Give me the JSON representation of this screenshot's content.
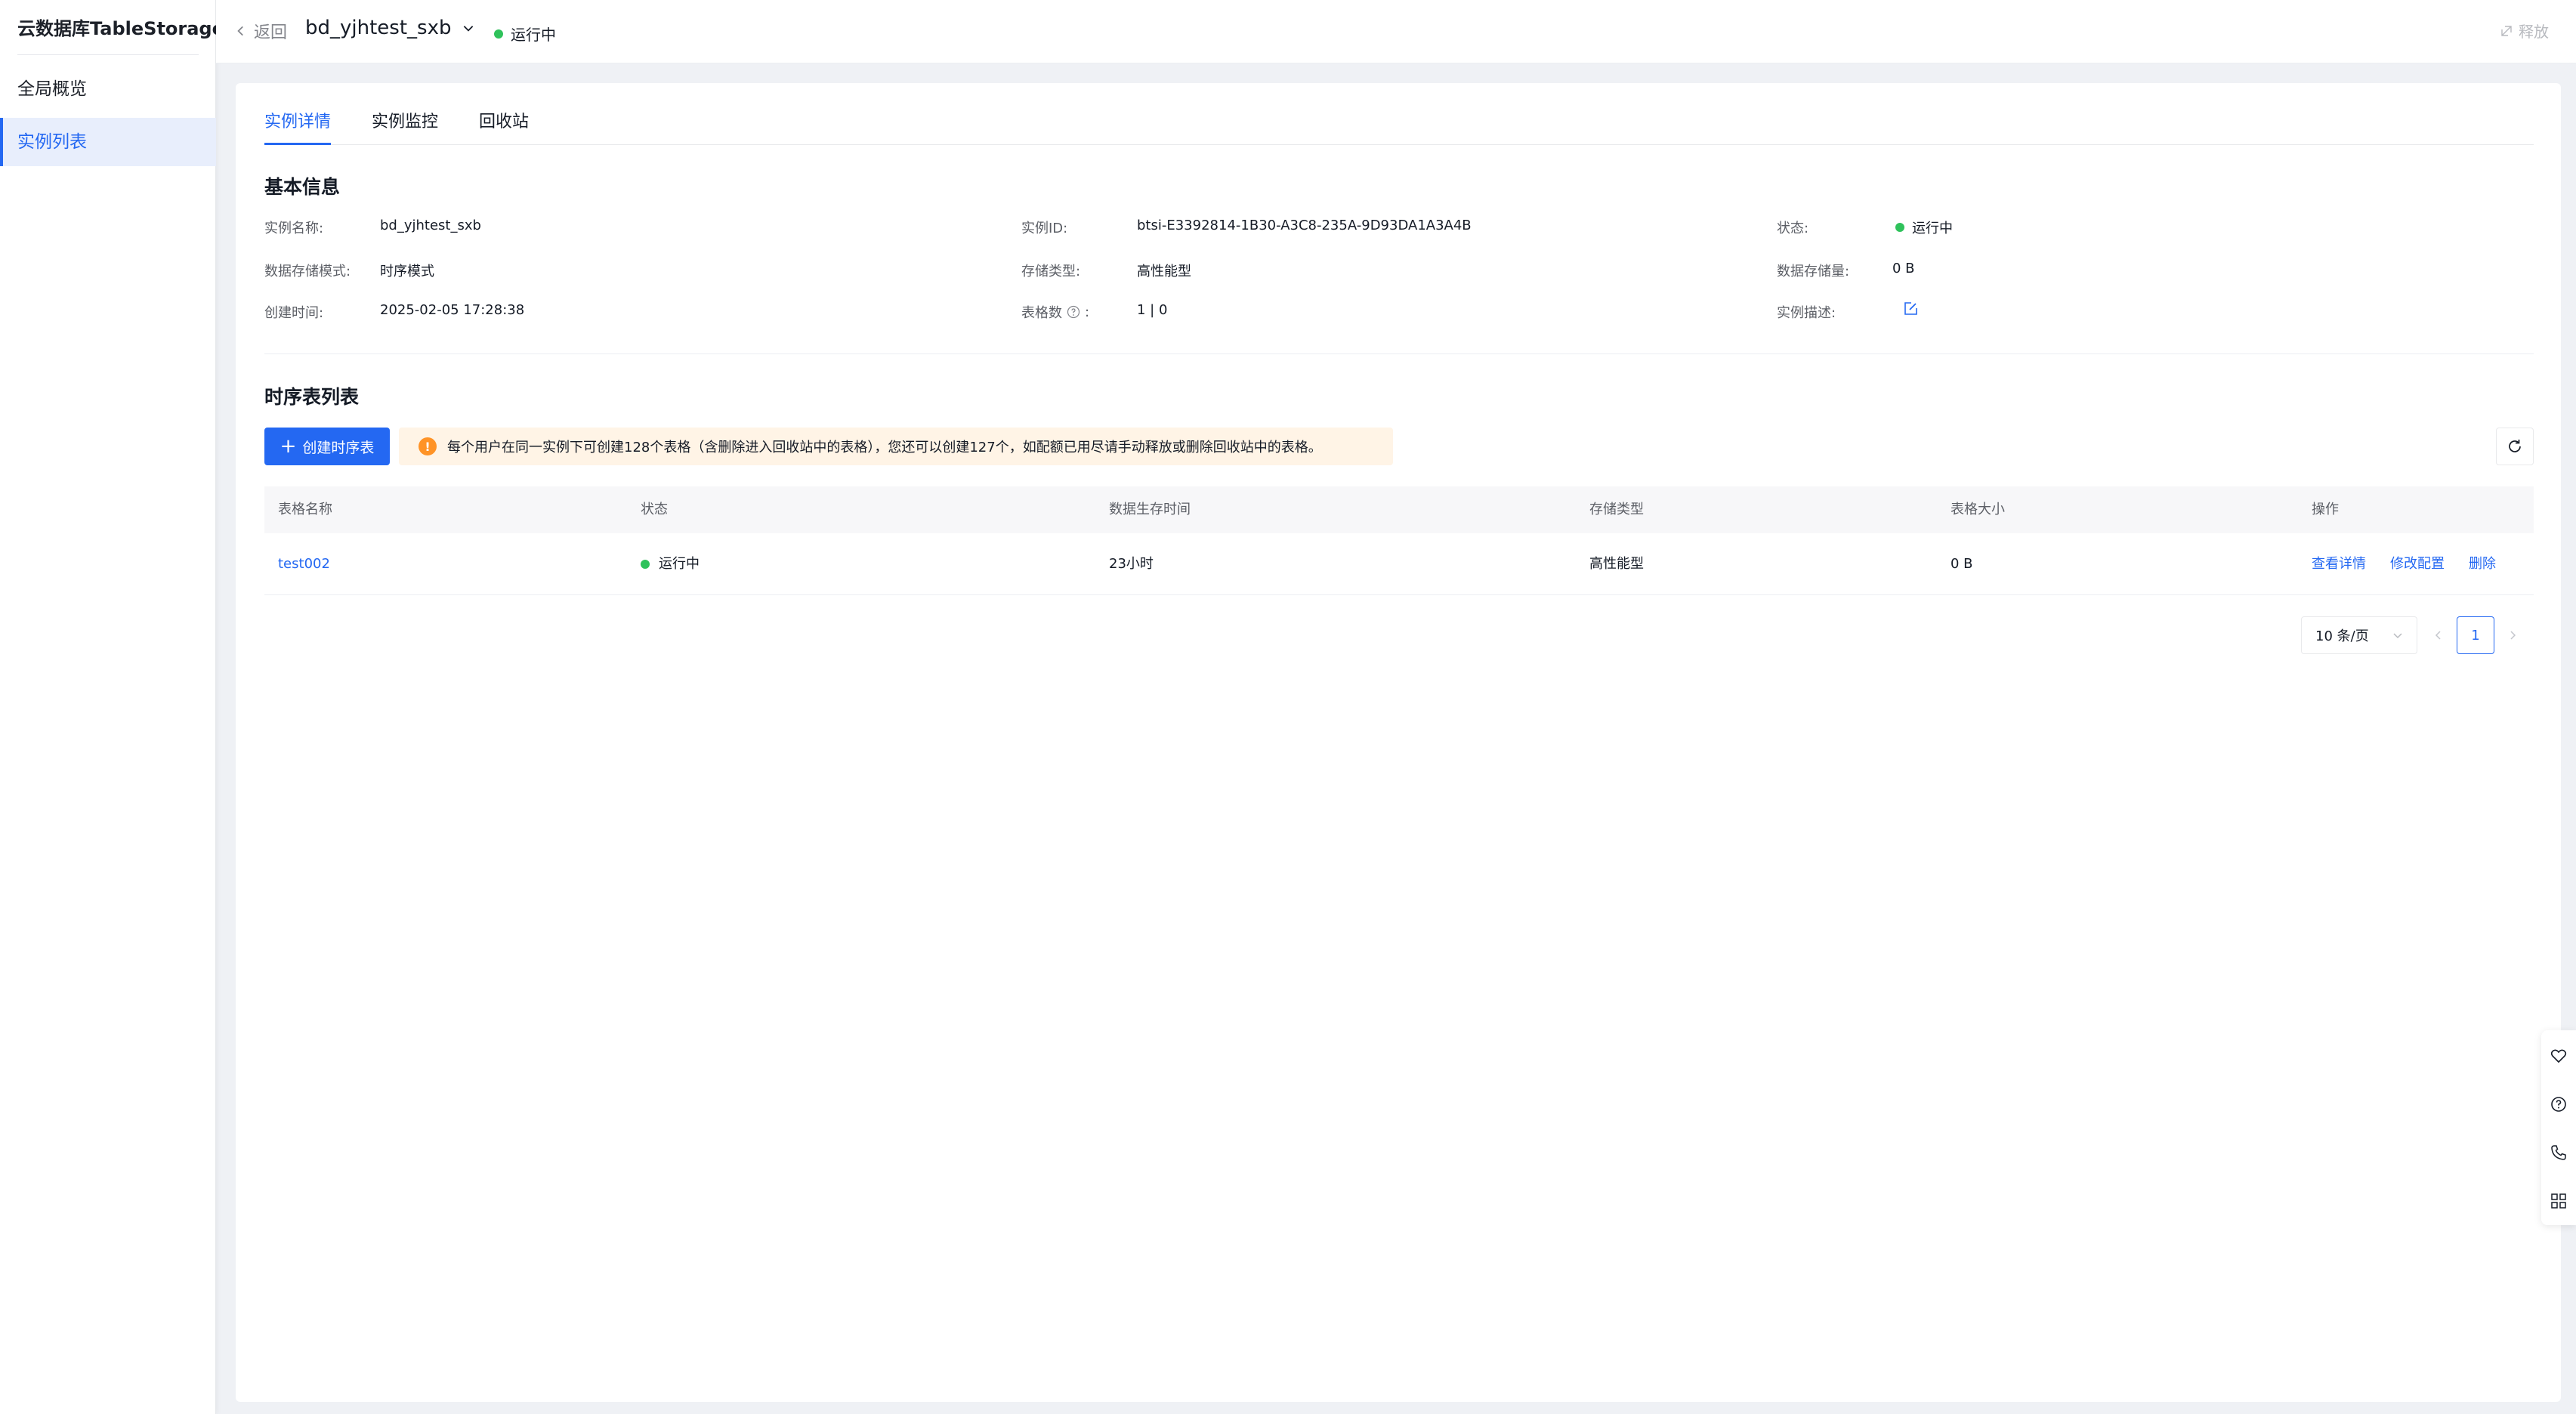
{
  "sidebar": {
    "title": "云数据库TableStorage",
    "items": [
      {
        "label": "全局概览",
        "active": false
      },
      {
        "label": "实例列表",
        "active": true
      }
    ]
  },
  "header": {
    "back_label": "返回",
    "instance_name": "bd_yjhtest_sxb",
    "status": "运行中",
    "release_label": "释放"
  },
  "tabs": [
    {
      "label": "实例详情",
      "active": true
    },
    {
      "label": "实例监控",
      "active": false
    },
    {
      "label": "回收站",
      "active": false
    }
  ],
  "basic_info": {
    "title": "基本信息",
    "instance_name_label": "实例名称:",
    "instance_name": "bd_yjhtest_sxb",
    "instance_id_label": "实例ID:",
    "instance_id": "btsi-E3392814-1B30-A3C8-235A-9D93DA1A3A4B",
    "status_label": "状态:",
    "status": "运行中",
    "storage_mode_label": "数据存储模式:",
    "storage_mode": "时序模式",
    "storage_type_label": "存储类型:",
    "storage_type": "高性能型",
    "storage_size_label": "数据存储量:",
    "storage_size": "0 B",
    "created_label": "创建时间:",
    "created": "2025-02-05 17:28:38",
    "table_count_label": "表格数",
    "table_count_colon": ":",
    "table_count": "1 | 0",
    "desc_label": "实例描述:"
  },
  "table_section": {
    "title": "时序表列表",
    "create_button": "创建时序表",
    "notice": "每个用户在同一实例下可创建128个表格（含删除进入回收站中的表格），您还可以创建127个，如配额已用尽请手动释放或删除回收站中的表格。",
    "columns": [
      "表格名称",
      "状态",
      "数据生存时间",
      "存储类型",
      "表格大小",
      "操作"
    ],
    "rows": [
      {
        "name": "test002",
        "status": "运行中",
        "ttl": "23小时",
        "storage_type": "高性能型",
        "size": "0 B",
        "actions": [
          "查看详情",
          "修改配置",
          "删除"
        ]
      }
    ]
  },
  "pagination": {
    "page_size": "10 条/页",
    "current_page": "1"
  },
  "colors": {
    "primary": "#2468f2",
    "running": "#2fc25b",
    "warning": "#ff9326",
    "notice_bg": "#fff4e6"
  },
  "icons": [
    "chevron-left-icon",
    "chevron-down-icon",
    "release-icon",
    "help-icon",
    "edit-icon",
    "plus-icon",
    "warning-icon",
    "refresh-icon",
    "chevron-right-icon",
    "heart-icon",
    "question-icon",
    "phone-icon",
    "grid-icon"
  ]
}
